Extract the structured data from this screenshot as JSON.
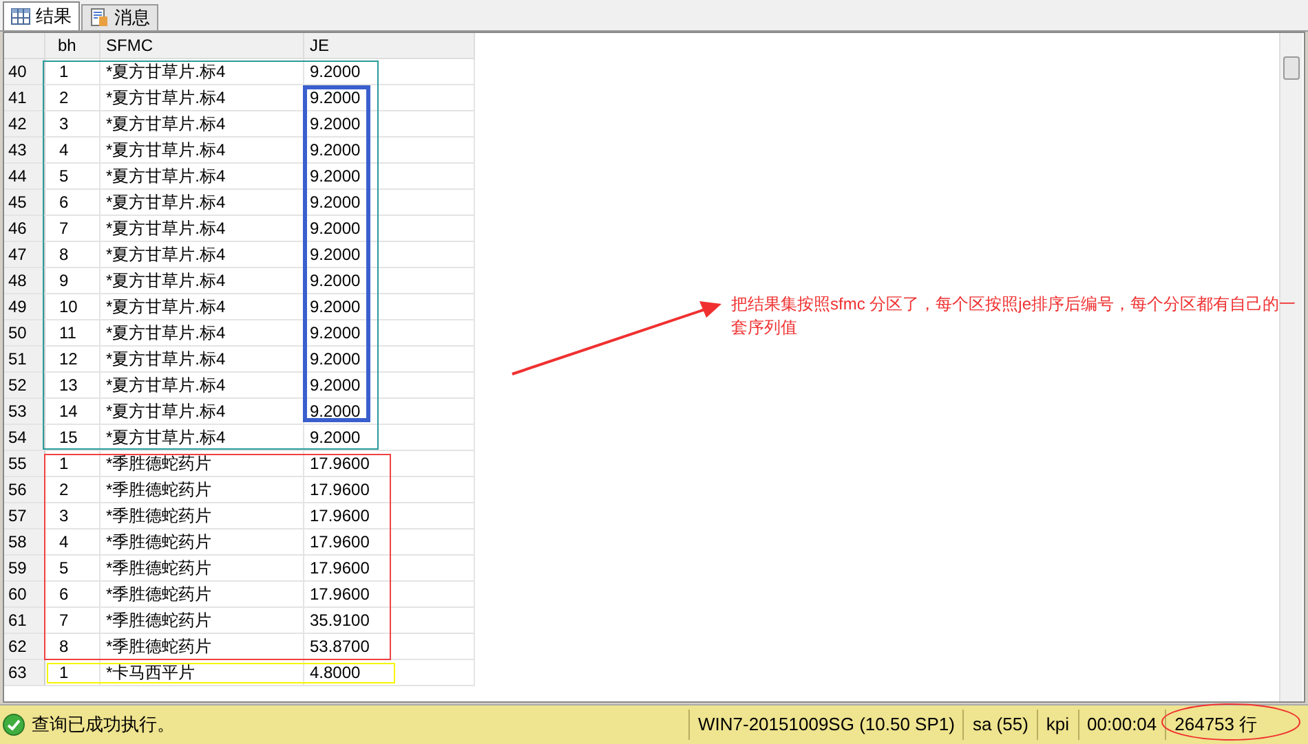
{
  "tabs": [
    {
      "label": "结果",
      "kind": "grid",
      "selected": true
    },
    {
      "label": "消息",
      "kind": "messages",
      "selected": false
    }
  ],
  "table": {
    "columns": [
      "bh",
      "SFMC",
      "JE"
    ],
    "rows": [
      {
        "row_number": "40",
        "cells": [
          "1",
          "*夏方甘草片.标4",
          "9.2000"
        ]
      },
      {
        "row_number": "41",
        "cells": [
          "2",
          "*夏方甘草片.标4",
          "9.2000"
        ]
      },
      {
        "row_number": "42",
        "cells": [
          "3",
          "*夏方甘草片.标4",
          "9.2000"
        ]
      },
      {
        "row_number": "43",
        "cells": [
          "4",
          "*夏方甘草片.标4",
          "9.2000"
        ]
      },
      {
        "row_number": "44",
        "cells": [
          "5",
          "*夏方甘草片.标4",
          "9.2000"
        ]
      },
      {
        "row_number": "45",
        "cells": [
          "6",
          "*夏方甘草片.标4",
          "9.2000"
        ]
      },
      {
        "row_number": "46",
        "cells": [
          "7",
          "*夏方甘草片.标4",
          "9.2000"
        ]
      },
      {
        "row_number": "47",
        "cells": [
          "8",
          "*夏方甘草片.标4",
          "9.2000"
        ]
      },
      {
        "row_number": "48",
        "cells": [
          "9",
          "*夏方甘草片.标4",
          "9.2000"
        ]
      },
      {
        "row_number": "49",
        "cells": [
          "10",
          "*夏方甘草片.标4",
          "9.2000"
        ]
      },
      {
        "row_number": "50",
        "cells": [
          "11",
          "*夏方甘草片.标4",
          "9.2000"
        ]
      },
      {
        "row_number": "51",
        "cells": [
          "12",
          "*夏方甘草片.标4",
          "9.2000"
        ]
      },
      {
        "row_number": "52",
        "cells": [
          "13",
          "*夏方甘草片.标4",
          "9.2000"
        ]
      },
      {
        "row_number": "53",
        "cells": [
          "14",
          "*夏方甘草片.标4",
          "9.2000"
        ]
      },
      {
        "row_number": "54",
        "cells": [
          "15",
          "*夏方甘草片.标4",
          "9.2000"
        ]
      },
      {
        "row_number": "55",
        "cells": [
          "1",
          "*季胜德蛇药片",
          "17.9600"
        ]
      },
      {
        "row_number": "56",
        "cells": [
          "2",
          "*季胜德蛇药片",
          "17.9600"
        ]
      },
      {
        "row_number": "57",
        "cells": [
          "3",
          "*季胜德蛇药片",
          "17.9600"
        ]
      },
      {
        "row_number": "58",
        "cells": [
          "4",
          "*季胜德蛇药片",
          "17.9600"
        ]
      },
      {
        "row_number": "59",
        "cells": [
          "5",
          "*季胜德蛇药片",
          "17.9600"
        ]
      },
      {
        "row_number": "60",
        "cells": [
          "6",
          "*季胜德蛇药片",
          "17.9600"
        ]
      },
      {
        "row_number": "61",
        "cells": [
          "7",
          "*季胜德蛇药片",
          "35.9100"
        ]
      },
      {
        "row_number": "62",
        "cells": [
          "8",
          "*季胜德蛇药片",
          "53.8700"
        ]
      },
      {
        "row_number": "63",
        "cells": [
          "1",
          "*卡马西平片",
          "4.8000"
        ]
      }
    ]
  },
  "annotation": "把结果集按照sfmc 分区了，每个区按照je排序后编号，每个分区都有自己的一套序列值",
  "status_bar": {
    "message": "查询已成功执行。",
    "server": "WIN7-20151009SG (10.50 SP1)",
    "user": "sa (55)",
    "database": "kpi",
    "elapsed": "00:00:04",
    "row_count": "264753 行"
  }
}
